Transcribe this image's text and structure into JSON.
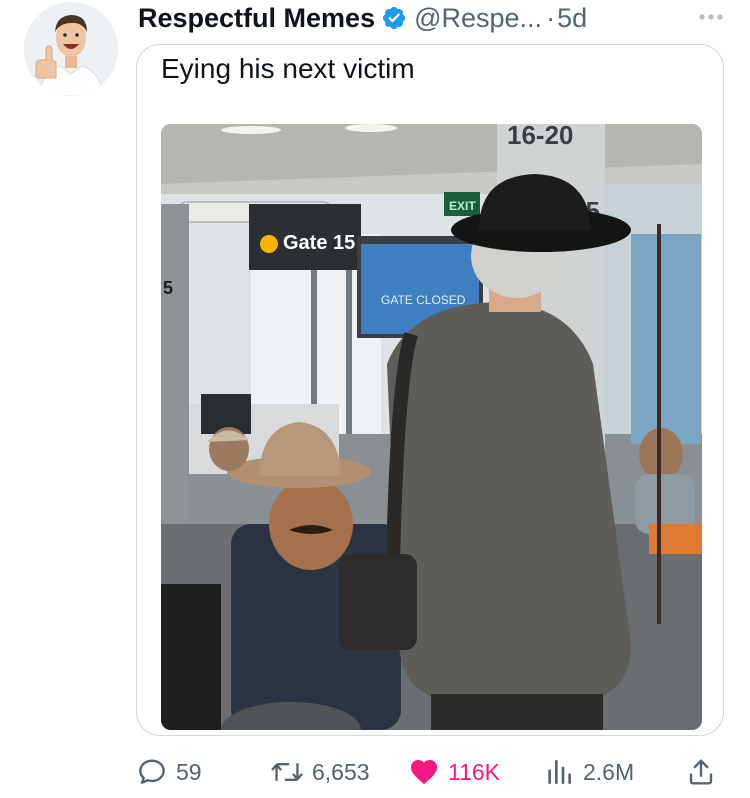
{
  "tweet": {
    "author": {
      "display_name": "Respectful Memes",
      "handle": "@Respe...",
      "separator": "·",
      "time": "5d",
      "verified": true
    },
    "text": "Eying his next victim",
    "photo": {
      "signs": {
        "gate_number": "Gate 15",
        "screen_text": "GATE CLOSED",
        "pillar_top": "16-20",
        "pillar_mid": "25",
        "exit": "EXIT",
        "left_pillar": "5"
      }
    },
    "actions": {
      "replies": "59",
      "retweets": "6,653",
      "likes": "116K",
      "views": "2.6M"
    }
  },
  "colors": {
    "text_primary": "#0f1419",
    "text_secondary": "#536471",
    "verified_blue": "#1d9bf0",
    "like_pink": "#f91880",
    "border": "#cfd9de"
  },
  "icons": {
    "more": "more-horizontal-icon",
    "verified": "verified-badge-icon",
    "reply": "reply-bubble-icon",
    "retweet": "retweet-arrows-icon",
    "like": "heart-filled-icon",
    "views": "bar-chart-icon",
    "share": "share-upload-icon"
  }
}
